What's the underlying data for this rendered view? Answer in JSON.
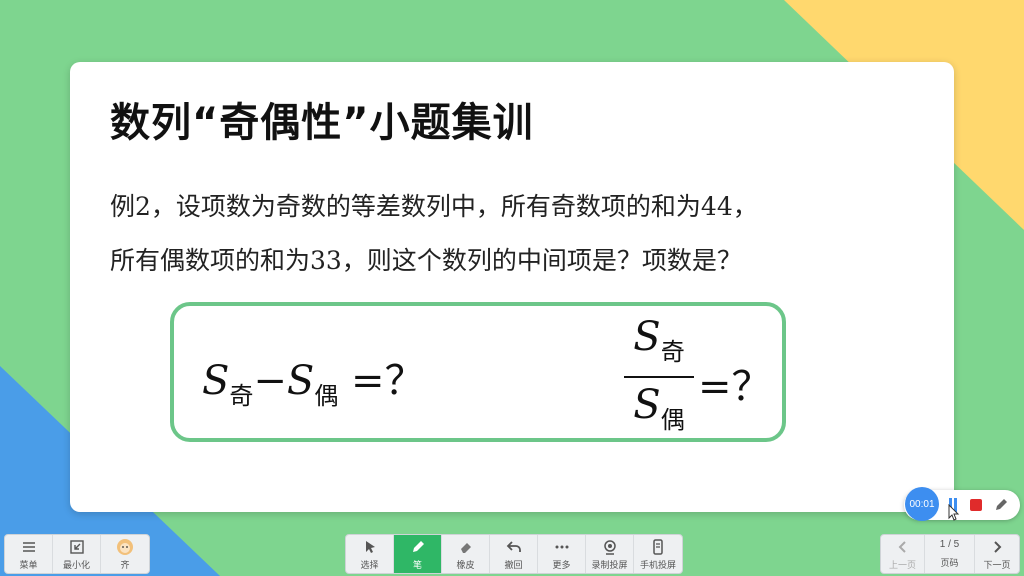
{
  "slide": {
    "title": "数列“奇偶性”小题集训",
    "problem_line1": "例2，设项数为奇数的等差数列中，所有奇数项的和为44，",
    "problem_line2": "所有偶数项的和为33，则这个数列的中间项是？项数是？",
    "formula1": {
      "var1": "S",
      "sub1": "奇",
      "minus": "−",
      "var2": "S",
      "sub2": "偶",
      "rhs": "=？"
    },
    "formula2": {
      "num_var": "S",
      "num_sub": "奇",
      "den_var": "S",
      "den_sub": "偶",
      "rhs": "=？"
    }
  },
  "toolbar": {
    "left": [
      {
        "label": "菜单",
        "icon": "menu-icon"
      },
      {
        "label": "最小化",
        "icon": "minimize-icon"
      },
      {
        "label": "齐",
        "icon": "avatar-icon"
      }
    ],
    "center": [
      {
        "label": "选择",
        "icon": "cursor-icon"
      },
      {
        "label": "笔",
        "icon": "pen-icon",
        "active": true
      },
      {
        "label": "橡皮",
        "icon": "eraser-icon"
      },
      {
        "label": "撤回",
        "icon": "undo-icon"
      },
      {
        "label": "更多",
        "icon": "more-icon"
      },
      {
        "label": "录制投屏",
        "icon": "record-icon"
      },
      {
        "label": "手机投屏",
        "icon": "phone-icon"
      }
    ],
    "right": {
      "prev_label": "上一页",
      "page_indicator": "1 / 5",
      "page_label": "页码",
      "next_label": "下一页"
    }
  },
  "recording": {
    "timer": "00:01"
  },
  "colors": {
    "background": "#7ed58f",
    "accent_green": "#2fb766",
    "box_border": "#6cc689",
    "record_blue": "#3d8ef0",
    "stop_red": "#e02b2b"
  }
}
